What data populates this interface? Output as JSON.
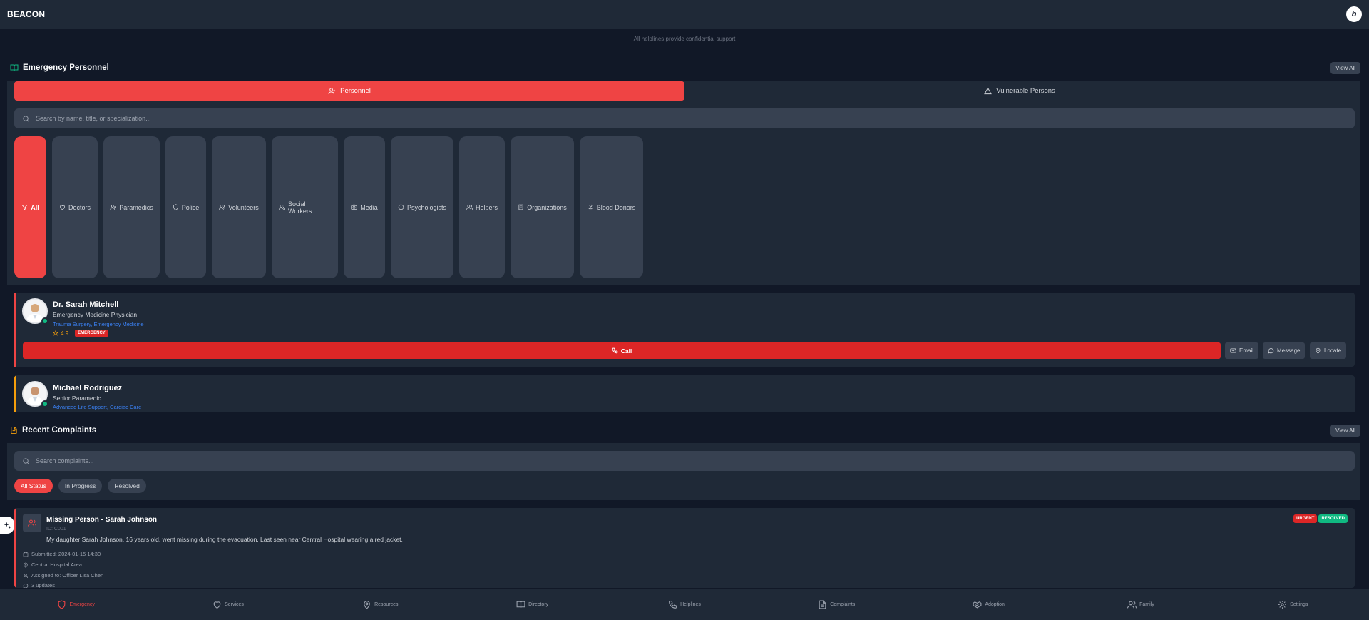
{
  "app": {
    "brand": "BEACON",
    "profile_initial": "b"
  },
  "notice": "All helplines provide confidential support",
  "personnel_section": {
    "title": "Emergency Personnel",
    "view_all": "View All",
    "tabs": [
      {
        "label": "Personnel",
        "active": true
      },
      {
        "label": "Vulnerable Persons",
        "active": false
      }
    ],
    "search_placeholder": "Search by name, title, or specialization...",
    "filters": [
      {
        "label": "All",
        "icon": "filter-icon",
        "active": true
      },
      {
        "label": "Doctors",
        "icon": "heart-icon"
      },
      {
        "label": "Paramedics",
        "icon": "user-plus-icon"
      },
      {
        "label": "Police",
        "icon": "shield-icon"
      },
      {
        "label": "Volunteers",
        "icon": "users-icon"
      },
      {
        "label": "Social Workers",
        "icon": "users-icon"
      },
      {
        "label": "Media",
        "icon": "camera-icon"
      },
      {
        "label": "Psychologists",
        "icon": "brain-icon"
      },
      {
        "label": "Helpers",
        "icon": "users-icon"
      },
      {
        "label": "Organizations",
        "icon": "building-icon"
      },
      {
        "label": "Blood Donors",
        "icon": "hand-heart-icon"
      }
    ],
    "people": [
      {
        "name": "Dr. Sarah Mitchell",
        "title": "Emergency Medicine Physician",
        "specialization": "Trauma Surgery, Emergency Medicine",
        "rating": "4.9",
        "badge": "EMERGENCY",
        "accent": "#ef4444",
        "actions": {
          "call": "Call",
          "email": "Email",
          "message": "Message",
          "locate": "Locate"
        }
      },
      {
        "name": "Michael Rodriguez",
        "title": "Senior Paramedic",
        "specialization": "Advanced Life Support, Cardiac Care",
        "accent": "#f59e0b"
      }
    ]
  },
  "complaints_section": {
    "title": "Recent Complaints",
    "view_all": "View All",
    "search_placeholder": "Search complaints...",
    "status_filters": [
      {
        "label": "All Status",
        "active": true
      },
      {
        "label": "In Progress",
        "active": false
      },
      {
        "label": "Resolved",
        "active": false
      }
    ],
    "items": [
      {
        "title": "Missing Person - Sarah Johnson",
        "id": "ID: C001",
        "description": "My daughter Sarah Johnson, 16 years old, went missing during the evacuation. Last seen near Central Hospital wearing a red jacket.",
        "submitted": "Submitted: 2024-01-15 14:30",
        "location": "Central Hospital Area",
        "assigned": "Assigned to: Officer Lisa Chen",
        "updates": "3 updates",
        "badges": [
          {
            "label": "URGENT",
            "color": "#dc2626"
          },
          {
            "label": "RESOLVED",
            "color": "#10b981"
          }
        ]
      }
    ]
  },
  "bottom_nav": [
    {
      "label": "Emergency",
      "icon": "shield-icon",
      "active": true
    },
    {
      "label": "Services",
      "icon": "heart-icon"
    },
    {
      "label": "Resources",
      "icon": "map-pin-icon"
    },
    {
      "label": "Directory",
      "icon": "book-open-icon"
    },
    {
      "label": "Helplines",
      "icon": "phone-icon"
    },
    {
      "label": "Complaints",
      "icon": "file-text-icon"
    },
    {
      "label": "Adoption",
      "icon": "handshake-icon"
    },
    {
      "label": "Family",
      "icon": "users-icon"
    },
    {
      "label": "Settings",
      "icon": "gear-icon"
    }
  ],
  "colors": {
    "accent": "#ef4444",
    "background": "#111827",
    "panel": "#1f2937",
    "link": "#3b82f6"
  }
}
